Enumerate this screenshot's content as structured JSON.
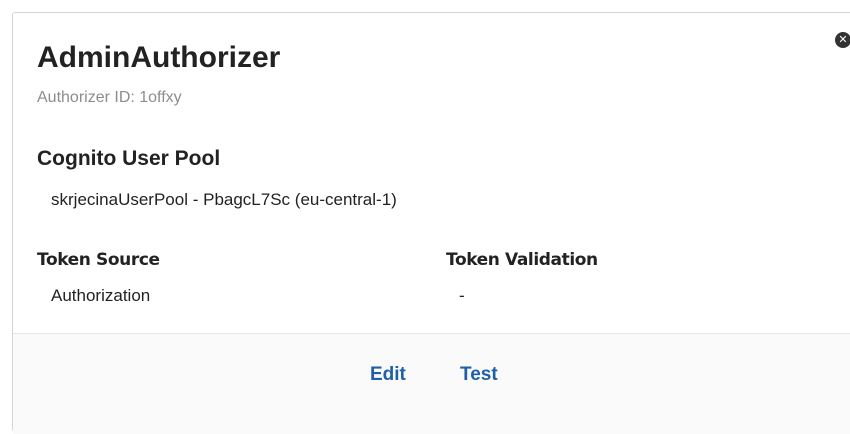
{
  "authorizer": {
    "name": "AdminAuthorizer",
    "id_label": "Authorizer ID: 1offxy"
  },
  "cognito": {
    "heading": "Cognito User Pool",
    "pool": "skrjecinaUserPool - PbagcL7Sc (eu-central-1)"
  },
  "token_source": {
    "label": "Token Source",
    "value": "Authorization"
  },
  "token_validation": {
    "label": "Token Validation",
    "value": "-"
  },
  "actions": {
    "edit_label": "Edit",
    "test_label": "Test"
  },
  "icons": {
    "close": "close-icon"
  },
  "colors": {
    "link": "#1f5fa8",
    "muted_text": "#8d8d8d",
    "border": "#d5d5d5"
  }
}
